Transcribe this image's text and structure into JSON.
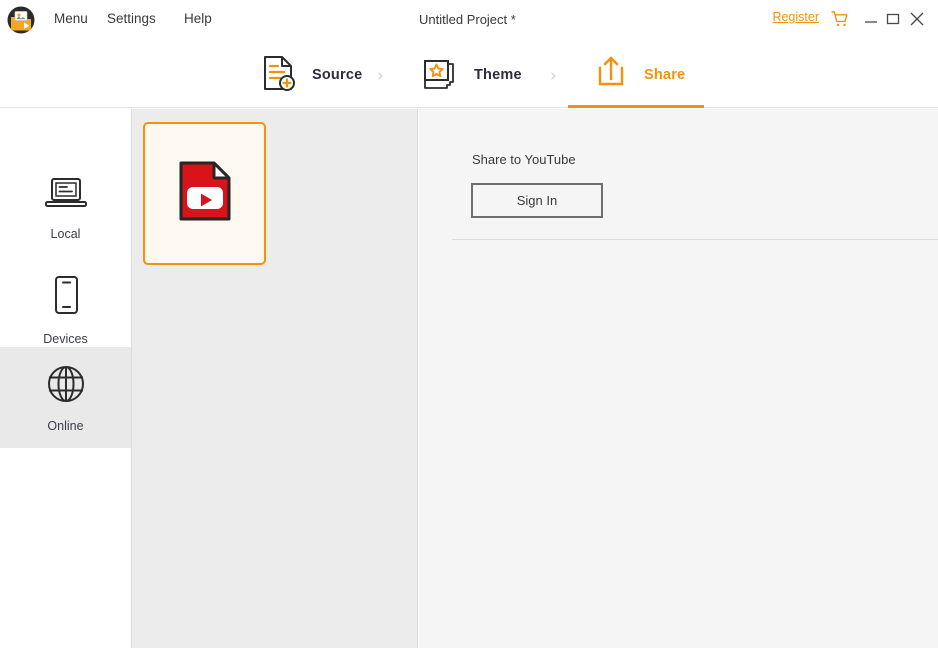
{
  "titlebar": {
    "logo_icon": "app-logo-folder-play-icon",
    "menus": [
      {
        "label": "Menu"
      },
      {
        "label": "Settings"
      },
      {
        "label": "Help"
      }
    ],
    "project_title": "Untitled Project *",
    "register_label": "Register",
    "cart_icon": "shopping-cart-icon",
    "minimize_icon": "minimize-icon",
    "maximize_icon": "maximize-icon",
    "close_icon": "close-icon"
  },
  "nav": {
    "steps": [
      {
        "label": "Source",
        "icon": "document-add-icon",
        "active": false
      },
      {
        "label": "Theme",
        "icon": "stacked-cards-star-icon",
        "active": false
      },
      {
        "label": "Share",
        "icon": "share-upload-icon",
        "active": true
      }
    ],
    "separator": "›",
    "active_color": "#F5910B",
    "inactive_color": "#2C2C3A"
  },
  "sidebar": {
    "items": [
      {
        "label": "Local",
        "icon": "laptop-icon",
        "selected": false
      },
      {
        "label": "Devices",
        "icon": "phone-icon",
        "selected": false
      },
      {
        "label": "Online",
        "icon": "globe-icon",
        "selected": true
      }
    ],
    "selected_bg": "#E9E9E9"
  },
  "targets": {
    "cards": [
      {
        "name": "YouTube",
        "icon": "youtube-file-icon",
        "selected": true
      }
    ],
    "selected_border": "#F5910B",
    "selected_bg": "#FDF8F0"
  },
  "panel": {
    "heading": "Share to YouTube",
    "signin_label": "Sign In"
  }
}
